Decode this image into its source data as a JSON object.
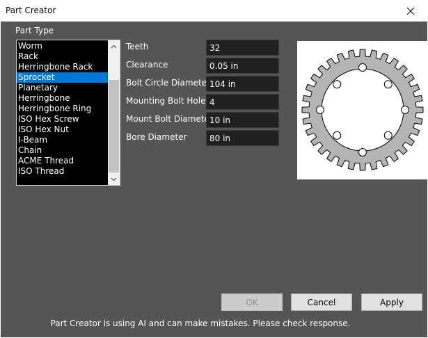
{
  "window": {
    "title": "Part Creator",
    "close_icon": "close-icon"
  },
  "part_type": {
    "label": "Part Type",
    "items": [
      "Worm",
      "Rack",
      "Herringbone Rack",
      "Sprocket",
      "Planetary",
      "Herringbone",
      "Herringbone Ring",
      "ISO Hex Screw",
      "ISO Hex Nut",
      "I-Beam",
      "Chain",
      "ACME Thread",
      "ISO Thread"
    ],
    "selected": "Sprocket"
  },
  "fields": [
    {
      "label": "Teeth",
      "value": "32"
    },
    {
      "label": "Clearance",
      "value": "0.05 in"
    },
    {
      "label": "Bolt Circle Diameter",
      "value": "104 in"
    },
    {
      "label": "Mounting Bolt Holes",
      "value": "4"
    },
    {
      "label": "Mount Bolt Diameter",
      "value": "10 in"
    },
    {
      "label": "Bore Diameter",
      "value": "80 in"
    }
  ],
  "preview": {
    "teeth": 32,
    "mounting_bolt_holes": 4,
    "body_color": "#b4b4b4",
    "outline_color": "#000000"
  },
  "buttons": {
    "ok": "OK",
    "cancel": "Cancel",
    "apply": "Apply"
  },
  "disclaimer": "Part Creator is using AI and can make mistakes. Please check response.",
  "colors": {
    "background": "#555555",
    "selection": "#0078d7",
    "input_bg": "#202020"
  }
}
